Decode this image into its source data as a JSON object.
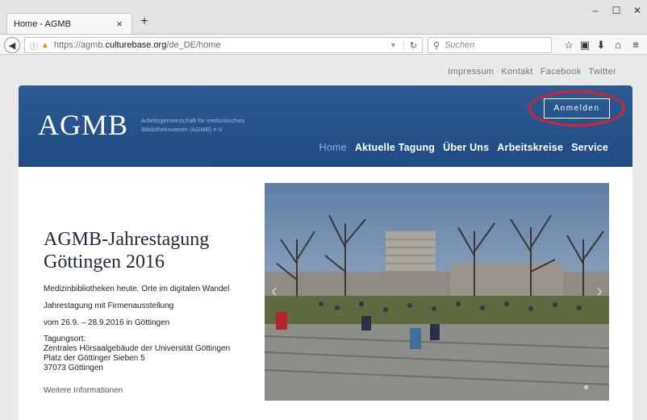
{
  "browser": {
    "tab_title": "Home - AGMB",
    "tab_close": "×",
    "new_tab": "+",
    "url_prefix": "https://agmb.",
    "url_domain": "culturebase.org",
    "url_path": "/de_DE/home",
    "search_placeholder": "Suchen",
    "win_minimize": "–",
    "win_maximize": "☐",
    "win_close": "✕"
  },
  "toplinks": [
    "Impressum",
    "Kontakt",
    "Facebook",
    "Twitter"
  ],
  "header": {
    "logo": "AGMB",
    "subtitle_line1": "Arbeitsgemeinschaft für medizinisches",
    "subtitle_line2": "Bibliothekswesen (AGMB) e.V.",
    "login_label": "Anmelden",
    "annotation_color": "#d9232c"
  },
  "nav": [
    "Home",
    "Aktuelle Tagung",
    "Über Uns",
    "Arbeitskreise",
    "Service"
  ],
  "hero": {
    "title": "AGMB-Jahrestagung Göttingen 2016",
    "line1": "Medizinbibliotheken heute. Orte im digitalen Wandel",
    "line2": "Jahrestagung mit Firmenausstellung",
    "line3": "vom 26.9. – 28.9.2016 in Göttingen",
    "addr1": "Tagungsort:",
    "addr2": "Zentrales Hörsaalgebäude der Universität Göttingen",
    "addr3": "Platz der Göttinger Sieben 5",
    "addr4": "37073 Göttingen",
    "more": "Weitere Informationen"
  },
  "colors": {
    "header_blue": "#1f4b82",
    "nav_active": "#8fb0d6",
    "toplink": "#6b7a86"
  }
}
